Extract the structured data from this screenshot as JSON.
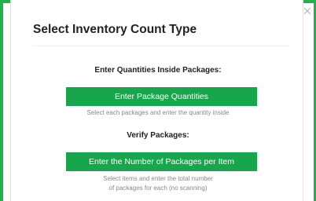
{
  "dialog": {
    "title": "Select Inventory Count Type",
    "close_icon": "close-icon",
    "accent_color": "#17a64b"
  },
  "sections": [
    {
      "heading": "Enter Quantities Inside Packages:",
      "button_label": "Enter Package Quantities",
      "description_lines": [
        "Select each packages and enter the quantity inside"
      ]
    },
    {
      "heading": "Verify Packages:",
      "button_label": "Enter the Number of Packages per Item",
      "description_lines": [
        "Select items and enter the total number",
        "of packages for each (no scanning)"
      ]
    }
  ]
}
